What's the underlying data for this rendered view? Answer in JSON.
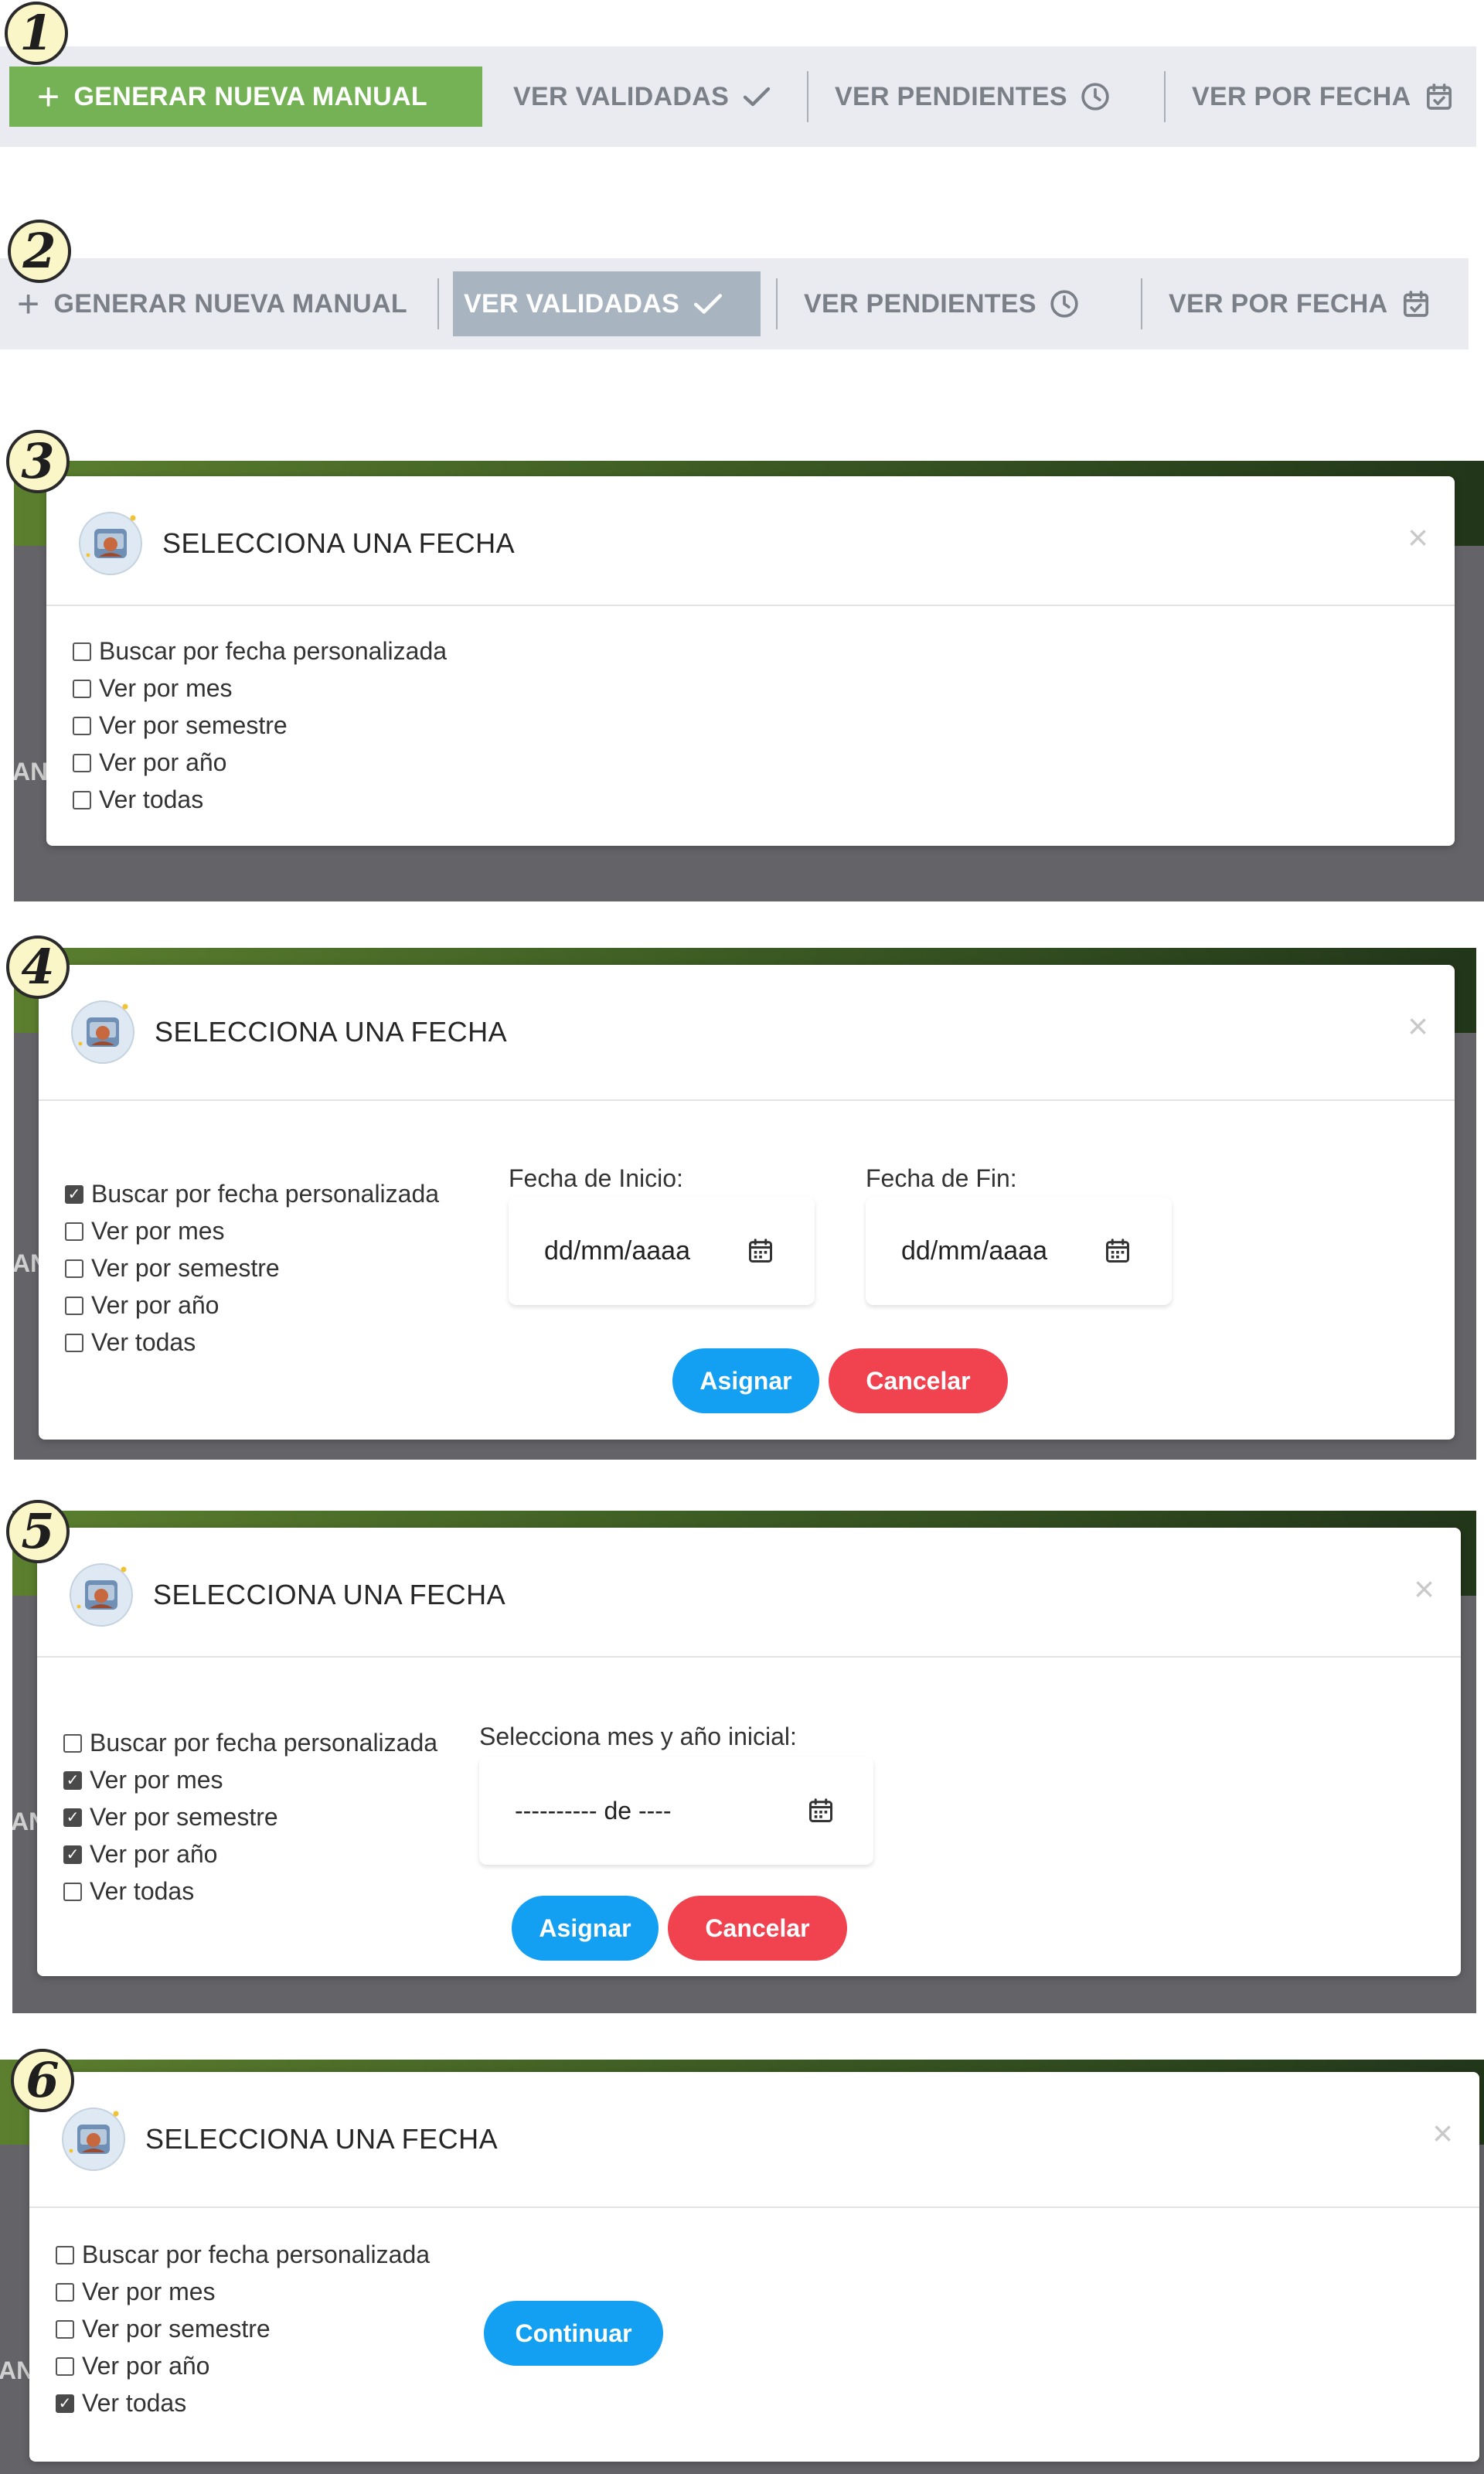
{
  "toolbar_labels": {
    "nueva": "GENERAR NUEVA MANUAL",
    "validadas": "VER VALIDADAS",
    "pendientes": "VER PENDIENTES",
    "fecha": "VER POR FECHA",
    "plus": "+"
  },
  "steps": [
    "1",
    "2",
    "3",
    "4",
    "5",
    "6"
  ],
  "colors": {
    "active_green": "#74b255",
    "active_gray": "#a9b4c1",
    "blue": "#139ff2",
    "red": "#f0424f",
    "header_green": "#4a6d27"
  },
  "dialog": {
    "title": "SELECCIONA UNA FECHA",
    "close": "×",
    "partial_text": "AN"
  },
  "options": [
    "Buscar por fecha personalizada",
    "Ver por mes",
    "Ver por semestre",
    "Ver por año",
    "Ver todas"
  ],
  "panel3": {
    "checked": [
      false,
      false,
      false,
      false,
      false
    ]
  },
  "panel4": {
    "checked": [
      true,
      false,
      false,
      false,
      false
    ],
    "start_label": "Fecha de Inicio:",
    "end_label": "Fecha de Fin:",
    "placeholder": "dd/mm/aaaa",
    "assign": "Asignar",
    "cancel": "Cancelar"
  },
  "panel5": {
    "checked": [
      false,
      true,
      true,
      true,
      false
    ],
    "month_label": "Selecciona mes y año inicial:",
    "month_value": "---------- de ----",
    "assign": "Asignar",
    "cancel": "Cancelar"
  },
  "panel6": {
    "checked": [
      false,
      false,
      false,
      false,
      true
    ],
    "continue": "Continuar"
  },
  "icons": [
    "plus-icon",
    "check-icon",
    "clock-icon",
    "calendar-check-icon",
    "calendar-icon",
    "close-icon",
    "logo-icon"
  ]
}
